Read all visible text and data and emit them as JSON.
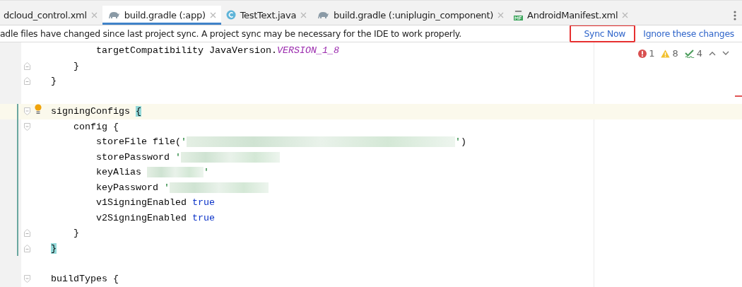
{
  "tabs": [
    {
      "label": "dcloud_control.xml",
      "kind": "plain",
      "selected": false
    },
    {
      "label": "build.gradle (:app)",
      "kind": "gradle",
      "selected": true
    },
    {
      "label": "TestText.java",
      "kind": "class",
      "selected": false
    },
    {
      "label": "build.gradle (:uniplugin_component)",
      "kind": "gradle",
      "selected": false
    },
    {
      "label": "AndroidManifest.xml",
      "kind": "manifest",
      "selected": false
    }
  ],
  "notification": {
    "message": "adle files have changed since last project sync. A project sync may be necessary for the IDE to work properly.",
    "actions": [
      {
        "label": "Sync Now",
        "highlighted": true
      },
      {
        "label": "Ignore these changes",
        "highlighted": false
      }
    ]
  },
  "inspections": [
    {
      "kind": "error",
      "count": "1"
    },
    {
      "kind": "warning",
      "count": "8"
    },
    {
      "kind": "typo",
      "count": "4"
    }
  ],
  "code_lines": [
    {
      "fold_start": false,
      "fold_end": false,
      "changed": false,
      "current": false,
      "intention": false,
      "tokens": [
        {
          "kind": "plain",
          "text": "        targetCompatibility JavaVersion."
        },
        {
          "kind": "constant",
          "text": "VERSION_1_8"
        }
      ]
    },
    {
      "fold_start": false,
      "fold_end": true,
      "changed": false,
      "current": false,
      "intention": false,
      "tokens": [
        {
          "kind": "plain",
          "text": "    }"
        }
      ]
    },
    {
      "fold_start": false,
      "fold_end": true,
      "changed": false,
      "current": false,
      "intention": false,
      "tokens": [
        {
          "kind": "plain",
          "text": "}"
        }
      ]
    },
    {
      "fold_start": false,
      "fold_end": false,
      "changed": false,
      "current": false,
      "intention": false
    },
    {
      "fold_start": true,
      "fold_end": false,
      "changed": true,
      "current": true,
      "intention": true,
      "tokens": [
        {
          "kind": "plain",
          "text": "signingConfigs "
        },
        {
          "kind": "brace-match",
          "text": "{"
        }
      ]
    },
    {
      "fold_start": true,
      "fold_end": false,
      "changed": true,
      "current": false,
      "intention": false,
      "tokens": [
        {
          "kind": "plain",
          "text": "    config {"
        }
      ]
    },
    {
      "fold_start": false,
      "fold_end": false,
      "changed": true,
      "current": false,
      "intention": false,
      "tokens": [
        {
          "kind": "plain",
          "text": "        storeFile file("
        },
        {
          "kind": "string",
          "text": "'"
        },
        {
          "kind": "redacted-long"
        },
        {
          "kind": "string",
          "text": "'"
        },
        {
          "kind": "plain",
          "text": ")"
        }
      ]
    },
    {
      "fold_start": false,
      "fold_end": false,
      "changed": true,
      "current": false,
      "intention": false,
      "tokens": [
        {
          "kind": "plain",
          "text": "        storePassword "
        },
        {
          "kind": "string",
          "text": "'"
        },
        {
          "kind": "redacted-medium"
        }
      ]
    },
    {
      "fold_start": false,
      "fold_end": false,
      "changed": true,
      "current": false,
      "intention": false,
      "tokens": [
        {
          "kind": "plain",
          "text": "        keyAlias "
        },
        {
          "kind": "redacted-short"
        },
        {
          "kind": "string",
          "text": "'"
        }
      ]
    },
    {
      "fold_start": false,
      "fold_end": false,
      "changed": true,
      "current": false,
      "intention": false,
      "tokens": [
        {
          "kind": "plain",
          "text": "        keyPassword "
        },
        {
          "kind": "string",
          "text": "'"
        },
        {
          "kind": "redacted-medium"
        }
      ]
    },
    {
      "fold_start": false,
      "fold_end": false,
      "changed": true,
      "current": false,
      "intention": false,
      "tokens": [
        {
          "kind": "plain",
          "text": "        v1SigningEnabled "
        },
        {
          "kind": "keyword",
          "text": "true"
        }
      ]
    },
    {
      "fold_start": false,
      "fold_end": false,
      "changed": true,
      "current": false,
      "intention": false,
      "tokens": [
        {
          "kind": "plain",
          "text": "        v2SigningEnabled "
        },
        {
          "kind": "keyword",
          "text": "true"
        }
      ]
    },
    {
      "fold_start": false,
      "fold_end": true,
      "changed": true,
      "current": false,
      "intention": false,
      "tokens": [
        {
          "kind": "plain",
          "text": "    }"
        }
      ]
    },
    {
      "fold_start": false,
      "fold_end": true,
      "changed": true,
      "current": false,
      "intention": false,
      "tokens": [
        {
          "kind": "brace-match",
          "text": "}"
        }
      ]
    },
    {
      "fold_start": false,
      "fold_end": false,
      "changed": false,
      "current": false,
      "intention": false
    },
    {
      "fold_start": true,
      "fold_end": false,
      "changed": false,
      "current": false,
      "intention": false,
      "tokens": [
        {
          "kind": "plain",
          "text": "buildTypes {"
        }
      ]
    }
  ]
}
